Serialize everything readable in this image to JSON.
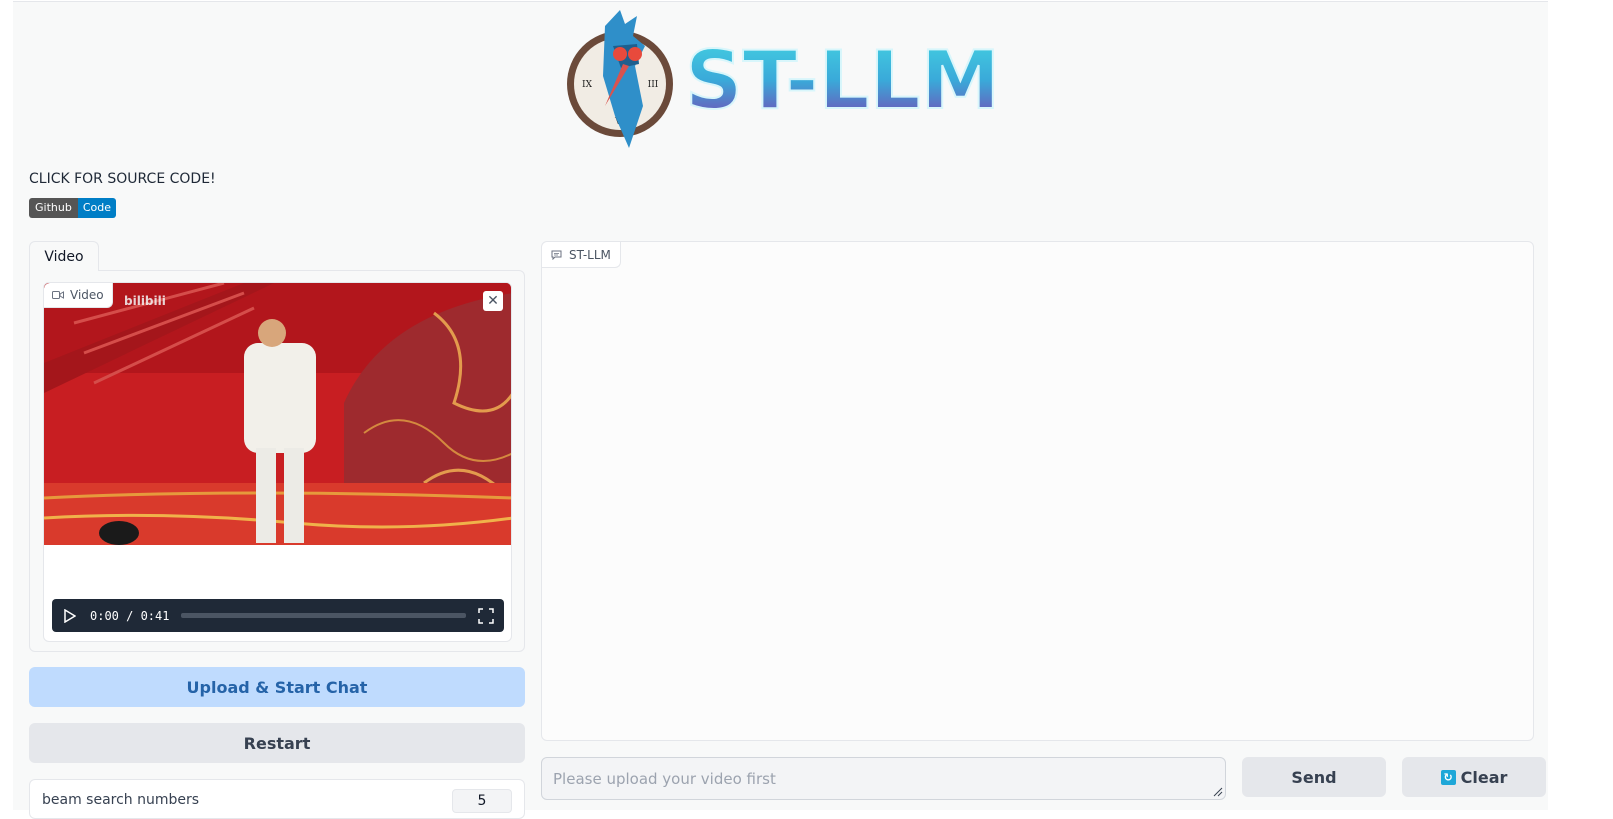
{
  "header": {
    "logo_text": "ST-LLM",
    "source_link_text": "CLICK FOR SOURCE CODE!",
    "badge_left": "Github",
    "badge_right": "Code"
  },
  "video_panel": {
    "tab_label": "Video",
    "box_label": "Video",
    "watermark": "bilibili",
    "time_display": "0:00 / 0:41",
    "progress": 0
  },
  "buttons": {
    "upload_label": "Upload & Start Chat",
    "restart_label": "Restart",
    "send_label": "Send",
    "clear_label": "Clear"
  },
  "beam_search": {
    "label": "beam search numbers",
    "value": "5"
  },
  "chatbot": {
    "label": "ST-LLM"
  },
  "message_input": {
    "placeholder": "Please upload your video first"
  },
  "colors": {
    "upload_bg": "#bfdbfe",
    "badge_left": "#555555",
    "badge_right": "#007ec6",
    "logo_gradient_top": "#3ec6dc",
    "logo_gradient_bottom": "#7b3fb0"
  }
}
